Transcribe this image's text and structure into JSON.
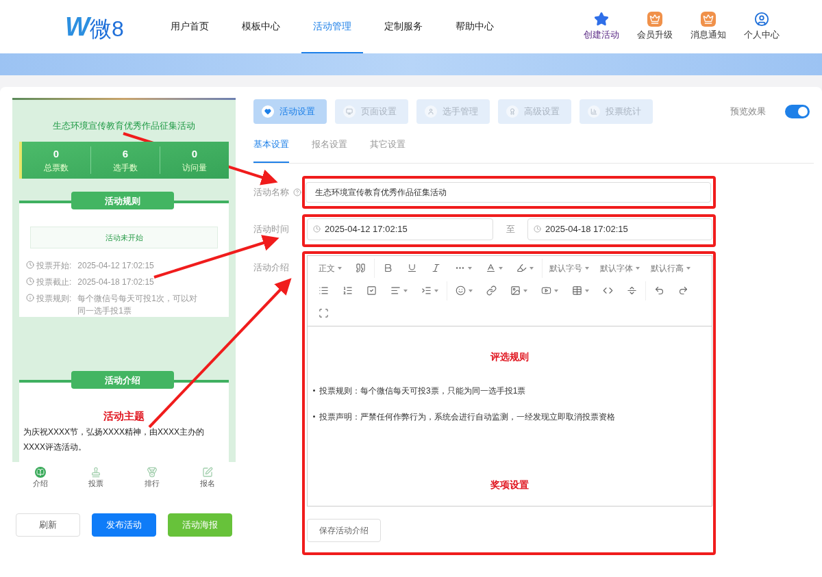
{
  "header": {
    "logo_mark": "W",
    "logo_text": "微8",
    "nav": [
      {
        "label": "用户首页",
        "selected": false
      },
      {
        "label": "模板中心",
        "selected": false
      },
      {
        "label": "活动管理",
        "selected": true
      },
      {
        "label": "定制服务",
        "selected": false
      },
      {
        "label": "帮助中心",
        "selected": false
      }
    ],
    "actions": [
      {
        "label": "创建活动",
        "kind": "stars"
      },
      {
        "label": "会员升级",
        "kind": "badge"
      },
      {
        "label": "消息通知",
        "kind": "badge"
      },
      {
        "label": "个人中心",
        "kind": "user"
      }
    ]
  },
  "preview": {
    "title": "生态环境宣传教育优秀作品征集活动",
    "stats": [
      {
        "value": "0",
        "label": "总票数"
      },
      {
        "value": "6",
        "label": "选手数"
      },
      {
        "value": "0",
        "label": "访问量"
      }
    ],
    "rules": {
      "heading": "活动规则",
      "status": "活动未开始",
      "items": [
        {
          "kind": "clock",
          "label": "投票开始:",
          "value": "2025-04-12 17:02:15"
        },
        {
          "kind": "clock",
          "label": "投票截止:",
          "value": "2025-04-18 17:02:15"
        },
        {
          "kind": "info",
          "label": "投票规则:",
          "value": "每个微信号每天可投1次，可以对同一选手投1票"
        }
      ]
    },
    "intro": {
      "heading": "活动介绍",
      "subtitle": "活动主题",
      "text": "为庆祝XXXX节，弘扬XXXX精神，由XXXX主办的XXXX评选活动。"
    },
    "bottom_nav": [
      {
        "label": "介绍",
        "selected": true
      },
      {
        "label": "投票",
        "selected": false
      },
      {
        "label": "排行",
        "selected": false
      },
      {
        "label": "报名",
        "selected": false
      }
    ]
  },
  "preview_buttons": [
    {
      "label": "刷新",
      "kind": "plain"
    },
    {
      "label": "发布活动",
      "kind": "primary"
    },
    {
      "label": "活动海报",
      "kind": "success"
    }
  ],
  "main_tabs": [
    {
      "label": "活动设置",
      "selected": true
    },
    {
      "label": "页面设置",
      "selected": false
    },
    {
      "label": "选手管理",
      "selected": false
    },
    {
      "label": "高级设置",
      "selected": false
    },
    {
      "label": "投票统计",
      "selected": false
    }
  ],
  "preview_toggle": {
    "label": "预览效果",
    "on": true
  },
  "sub_tabs": [
    {
      "label": "基本设置",
      "selected": true
    },
    {
      "label": "报名设置",
      "selected": false
    },
    {
      "label": "其它设置",
      "selected": false
    }
  ],
  "form": {
    "name": {
      "label": "活动名称",
      "value": "生态环境宣传教育优秀作品征集活动"
    },
    "time": {
      "label": "活动时间",
      "start": "2025-04-12 17:02:15",
      "separator": "至",
      "end": "2025-04-18 17:02:15"
    },
    "intro": {
      "label": "活动介绍",
      "toolbar_labels": [
        "正文",
        "默认字号",
        "默认字体",
        "默认行高"
      ],
      "content": [
        {
          "kind": "heading",
          "text": "评选规则"
        },
        {
          "kind": "bullet",
          "text": "投票规则：每个微信每天可投3票，只能为同一选手投1票"
        },
        {
          "kind": "bullet",
          "text": "投票声明：严禁任何作弊行为，系统会进行自动监测，一经发现立即取消投票资格"
        },
        {
          "kind": "heading",
          "text": "奖项设置"
        }
      ],
      "save_button": "保存活动介绍"
    }
  }
}
